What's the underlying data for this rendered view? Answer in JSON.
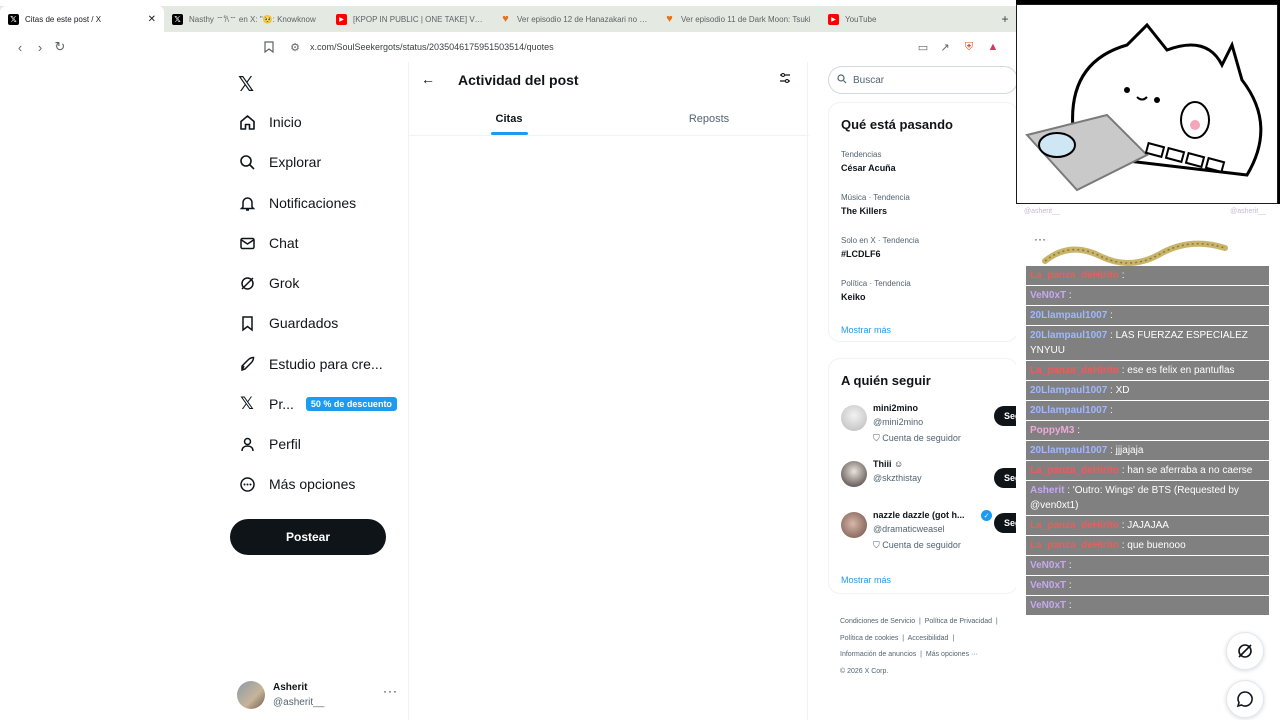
{
  "browser": {
    "tabs": [
      {
        "title": "Citas de este post / X",
        "icon": "x-logo-icon",
        "active": true
      },
      {
        "title": "Nasthy ⌔𐙚⌔ en X: \"🥺: Knowknow",
        "icon": "x-logo-icon"
      },
      {
        "title": "[KPOP IN PUBLIC | ONE TAKE] VIVIZ",
        "icon": "youtube-icon"
      },
      {
        "title": "Ver episodio 12 de Hanazakari no Kimi",
        "icon": "crunchy-icon"
      },
      {
        "title": "Ver episodio 11 de Dark Moon: Tsuki",
        "icon": "crunchy-icon"
      },
      {
        "title": "YouTube",
        "icon": "youtube-icon"
      }
    ],
    "url": "x.com/SoulSeekergots/status/2035046175951503514/quotes"
  },
  "nav": {
    "items": [
      {
        "label": "Inicio",
        "icon": "home-icon"
      },
      {
        "label": "Explorar",
        "icon": "search-icon"
      },
      {
        "label": "Notificaciones",
        "icon": "bell-icon"
      },
      {
        "label": "Chat",
        "icon": "mail-icon"
      },
      {
        "label": "Grok",
        "icon": "grok-icon"
      },
      {
        "label": "Guardados",
        "icon": "bookmark-icon"
      },
      {
        "label": "Estudio para cre...",
        "icon": "rocket-icon"
      },
      {
        "label": "Pr...",
        "icon": "x-logo-icon",
        "badge": "50 % de descuento"
      },
      {
        "label": "Perfil",
        "icon": "person-icon"
      },
      {
        "label": "Más opciones",
        "icon": "more-circle-icon"
      }
    ],
    "post_button": "Postear",
    "profile": {
      "name": "Asherit",
      "handle": "@asherit__"
    }
  },
  "main": {
    "title": "Actividad del post",
    "tabs": [
      {
        "label": "Citas"
      },
      {
        "label": "Reposts"
      }
    ]
  },
  "right": {
    "search_placeholder": "Buscar",
    "trends_title": "Qué está pasando",
    "trends": [
      {
        "context": "Tendencias",
        "name": "César Acuña"
      },
      {
        "context": "Música · Tendencia",
        "name": "The Killers"
      },
      {
        "context": "Solo en X · Tendencia",
        "name": "#LCDLF6"
      },
      {
        "context": "Política · Tendencia",
        "name": "Keiko"
      }
    ],
    "trends_more": "Mostrar más",
    "follow_title": "A quién seguir",
    "follow": [
      {
        "name": "mini2mino",
        "handle": "@mini2mino",
        "sub": "Cuenta de seguidor",
        "button": "Segui"
      },
      {
        "name": "Thiii ☺",
        "handle": "@skzthistay",
        "sub": "",
        "button": "Segui"
      },
      {
        "name": "nazzle dazzle (got h...",
        "handle": "@dramaticweasel",
        "sub": "Cuenta de seguidor",
        "button": "Segui",
        "verified": true
      }
    ],
    "follow_more": "Mostrar más",
    "footer": [
      "Condiciones de Servicio",
      "Política de Privacidad",
      "Política de cookies",
      "Accesibilidad",
      "Información de anuncios",
      "Más opciones ···",
      "© 2026 X Corp."
    ]
  },
  "overlay": {
    "tag_left": "@asherit__",
    "tag_right": "@asherit__",
    "chat": [
      {
        "user": "La_panza_deHirito",
        "text": ":",
        "color": "red"
      },
      {
        "user": "VeN0xT",
        "text": ":",
        "color": "purple"
      },
      {
        "user": "20Llampaul1007",
        "text": ":",
        "color": "blue"
      },
      {
        "user": "20Llampaul1007",
        "text": ": LAS FUERZAZ ESPECIALEZ YNYUU",
        "color": "blue"
      },
      {
        "user": "La_panza_deHirito",
        "text": ": ese es felix en pantuflas",
        "color": "red"
      },
      {
        "user": "20Llampaul1007",
        "text": ": XD",
        "color": "blue"
      },
      {
        "user": "20Llampaul1007",
        "text": ":",
        "color": "blue"
      },
      {
        "user": "PoppyM3",
        "text": ":",
        "color": "pink"
      },
      {
        "user": "20Llampaul1007",
        "text": ": jjjajaja",
        "color": "blue"
      },
      {
        "user": "La_panza_deHirito",
        "text": ": han se aferraba a no caerse",
        "color": "red"
      },
      {
        "user": "Asherit",
        "text": ": 'Outro: Wings' de BTS (Requested by @ven0xt1)",
        "color": "purple"
      },
      {
        "user": "La_panza_deHirito",
        "text": ": JAJAJAA",
        "color": "red"
      },
      {
        "user": "La_panza_deHirito",
        "text": ": que buenooo",
        "color": "red"
      },
      {
        "user": "VeN0xT",
        "text": ":",
        "color": "purple"
      },
      {
        "user": "VeN0xT",
        "text": ":",
        "color": "purple"
      },
      {
        "user": "VeN0xT",
        "text": ":",
        "color": "purple"
      }
    ]
  },
  "colors": {
    "accent": "#1d9bf0",
    "text": "#0f1419",
    "muted": "#536471"
  }
}
